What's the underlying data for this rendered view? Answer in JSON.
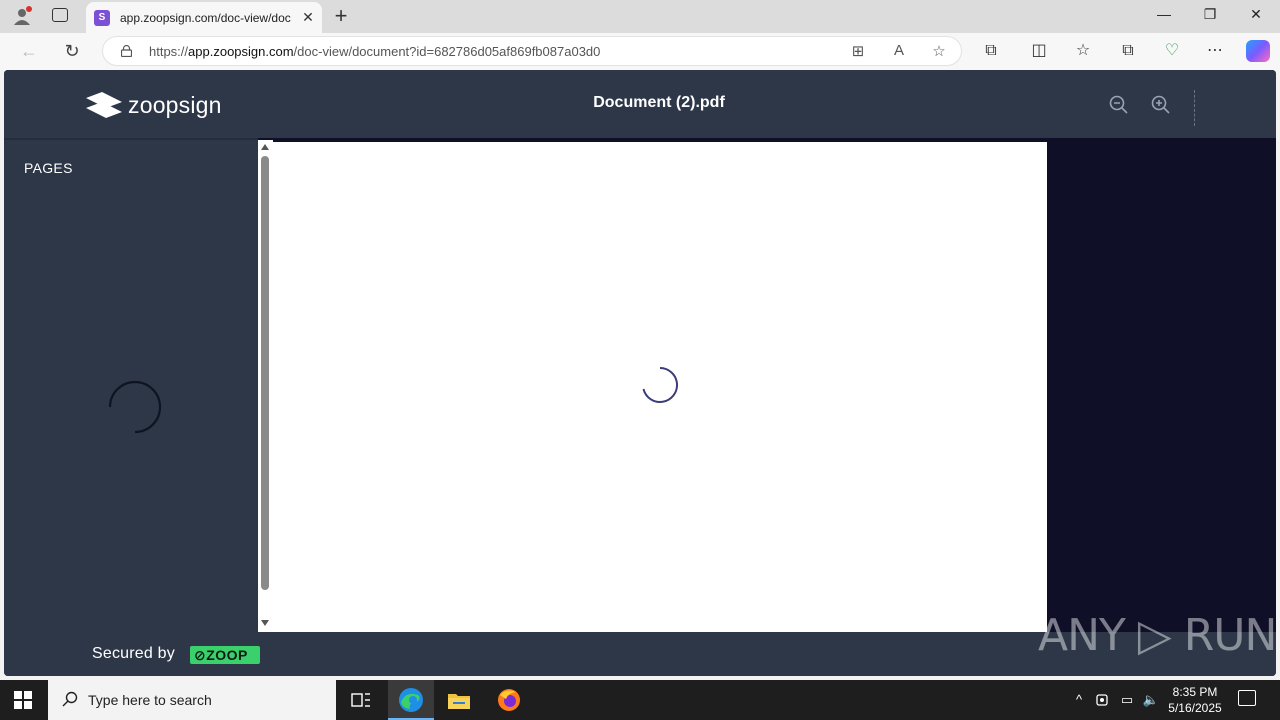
{
  "browser": {
    "tab_title": "app.zoopsign.com/doc-view/doc",
    "tab_favicon_letter": "S",
    "tab_close": "✕",
    "new_tab": "+",
    "window_controls": {
      "minimize": "—",
      "restore": "❐",
      "close": "✕"
    },
    "url_prefix": "https://",
    "url_host": "app.zoopsign.com",
    "url_path": "/doc-view/document?id=682786d05af869fb087a03d0",
    "icons": {
      "back": "←",
      "refresh": "↻",
      "apps": "⊞",
      "read_aloud": "A",
      "favorite": "☆",
      "extensions": "⧉",
      "split": "◫",
      "favorites": "☆",
      "collections": "⧉",
      "performance": "♡",
      "more": "⋯"
    }
  },
  "app": {
    "logo_text": "zoopsign",
    "document_title": "Document (2).pdf",
    "sidebar_label": "PAGES",
    "footer_secured": "Secured by",
    "footer_badge": "⊘ZOOP",
    "colors": {
      "header": "#2d3748",
      "canvas": "#0f1028",
      "spinner": "#3a3d7a",
      "badge": "#3ad06c"
    }
  },
  "watermark": "ANY ▷ RUN",
  "taskbar": {
    "search_placeholder": "Type here to search",
    "time": "8:35 PM",
    "date": "5/16/2025",
    "tray": {
      "chevron": "^",
      "network": "▭",
      "volume": "🔈"
    }
  }
}
